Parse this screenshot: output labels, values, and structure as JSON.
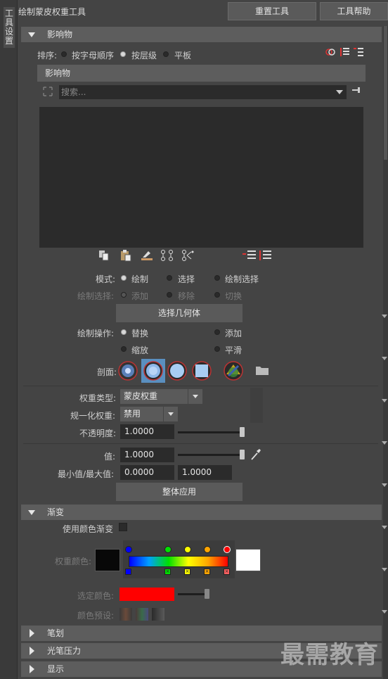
{
  "vtab": {
    "label": "工具设置"
  },
  "top": {
    "title": "绘制蒙皮权重工具",
    "reset_btn": "重置工具",
    "help_btn": "工具帮助"
  },
  "influences": {
    "header": "影响物",
    "sort_label": "排序:",
    "sort_options": [
      "按字母顺序",
      "按层级",
      "平板"
    ],
    "sort_selected": 1,
    "list_header": "影响物",
    "search_placeholder": "搜索..."
  },
  "mode": {
    "label": "模式:",
    "options": [
      "绘制",
      "选择",
      "绘制选择"
    ],
    "selected": 0
  },
  "paint_select": {
    "label": "绘制选择:",
    "options": [
      "添加",
      "移除",
      "切换"
    ],
    "selected": 0
  },
  "select_geometry_btn": "选择几何体",
  "paint_op": {
    "label": "绘制操作:",
    "options": [
      "替换",
      "添加",
      "缩放",
      "平滑"
    ],
    "selected": 0
  },
  "profile": {
    "label": "剖面:"
  },
  "weight_type": {
    "label": "权重类型:",
    "value": "蒙皮权重"
  },
  "normalize": {
    "label": "规一化权重:",
    "value": "禁用"
  },
  "opacity": {
    "label": "不透明度:",
    "value": "1.0000",
    "level": 1.0
  },
  "value": {
    "label": "值:",
    "value": "1.0000",
    "level": 1.0
  },
  "minmax": {
    "label": "最小值/最大值:",
    "min": "0.0000",
    "max": "1.0000"
  },
  "flood_btn": "整体应用",
  "gradient": {
    "header": "渐变",
    "use_color_ramp": "使用颜色渐变",
    "weight_color": "权重颜色:",
    "selected_color": "选定颜色:",
    "selected_color_hex": "#ff0000",
    "color_presets": "颜色预设:",
    "ramp_colors": [
      "#0000ff",
      "#00e000",
      "#ffff00",
      "#ffa500",
      "#ff0000"
    ]
  },
  "sections": [
    "笔划",
    "光笔压力",
    "显示"
  ],
  "watermark": "最需教育"
}
